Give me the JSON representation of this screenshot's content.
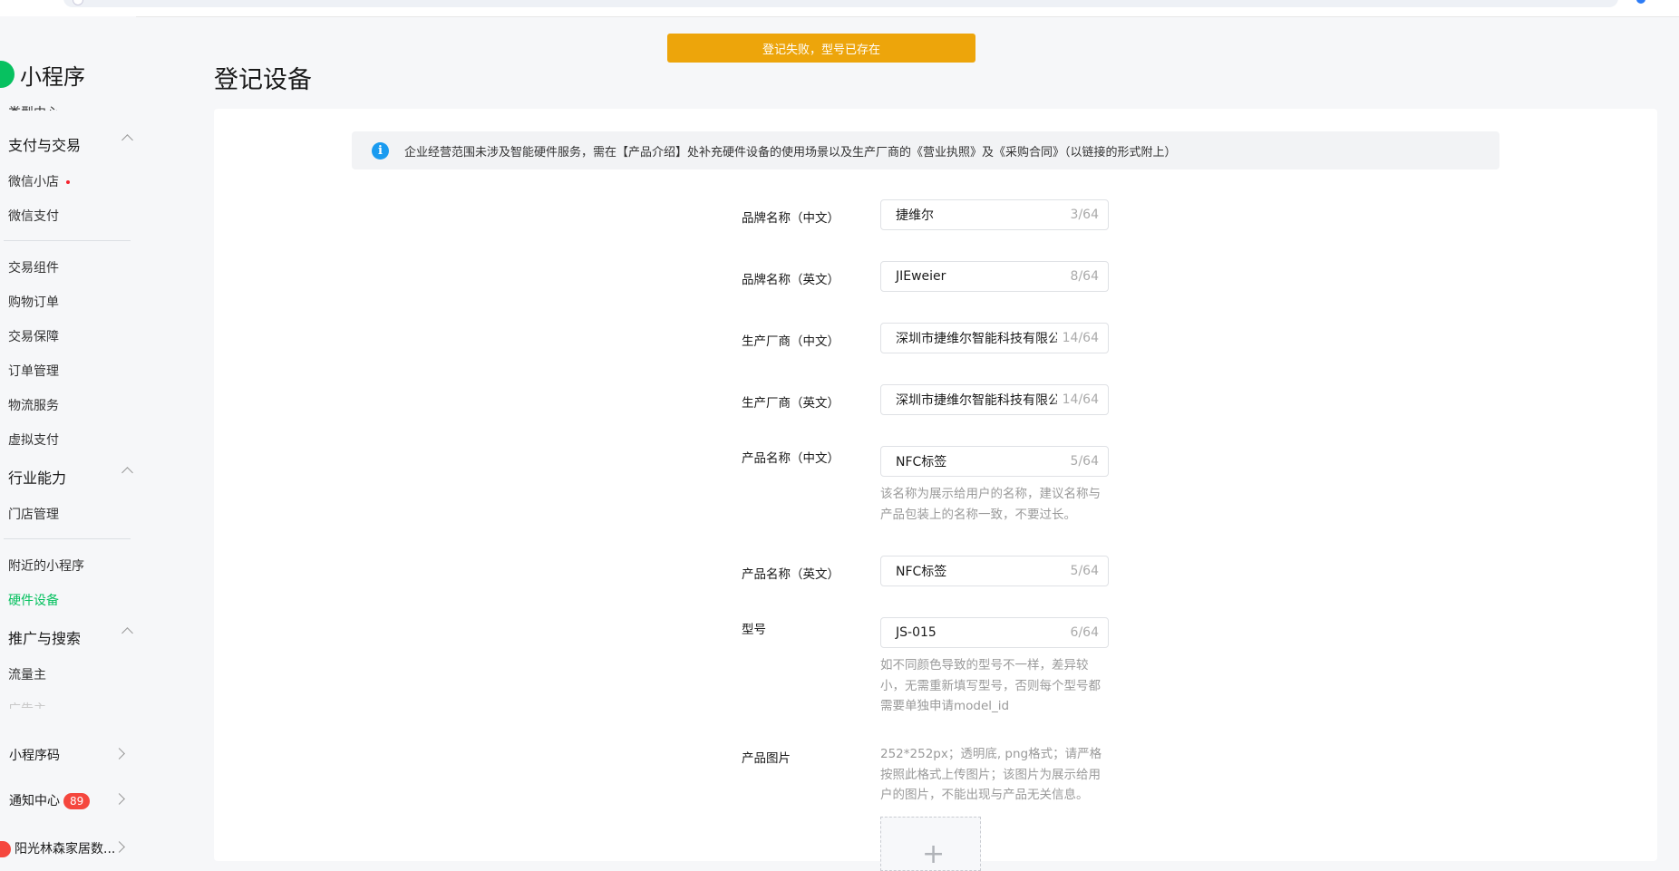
{
  "app": {
    "name": "小程序"
  },
  "toast": {
    "message": "登记失败，型号已存在"
  },
  "page": {
    "title": "登记设备"
  },
  "sidebar": {
    "cut_item": "类型中心",
    "pay_section": {
      "label": "支付与交易",
      "items": [
        "微信小店",
        "微信支付"
      ]
    },
    "trade_items": [
      "交易组件",
      "购物订单",
      "交易保障",
      "订单管理",
      "物流服务",
      "虚拟支付"
    ],
    "industry_section": {
      "label": "行业能力",
      "items": [
        "门店管理"
      ]
    },
    "industry_items2": [
      "附近的小程序",
      "硬件设备"
    ],
    "promo_section": {
      "label": "推广与搜索",
      "items": [
        "流量主",
        "广告主"
      ]
    },
    "bottom": {
      "qrcode": "小程序码",
      "notice": "通知中心",
      "notice_count": "89",
      "account": "阳光林森家居数..."
    }
  },
  "notice": {
    "text": "企业经营范围未涉及智能硬件服务，需在【产品介绍】处补充硬件设备的使用场景以及生产厂商的《营业执照》及《采购合同》（以链接的形式附上）"
  },
  "form": {
    "brand_cn": {
      "label": "品牌名称（中文）",
      "value": "捷维尔",
      "count": "3/64"
    },
    "brand_en": {
      "label": "品牌名称（英文）",
      "value": "JIEweier",
      "count": "8/64"
    },
    "maker_cn": {
      "label": "生产厂商（中文）",
      "value": "深圳市捷维尔智能科技有限公司",
      "count": "14/64"
    },
    "maker_en": {
      "label": "生产厂商（英文）",
      "value": "深圳市捷维尔智能科技有限公司",
      "count": "14/64"
    },
    "product_cn": {
      "label": "产品名称（中文）",
      "value": "NFC标签",
      "count": "5/64",
      "hint": "该名称为展示给用户的名称，建议名称与产品包装上的名称一致，不要过长。"
    },
    "product_en": {
      "label": "产品名称（英文）",
      "value": "NFC标签",
      "count": "5/64"
    },
    "model": {
      "label": "型号",
      "value": "JS-015",
      "count": "6/64",
      "hint": "如不同颜色导致的型号不一样，差异较小，无需重新填写型号，否则每个型号都需要单独申请model_id"
    },
    "image": {
      "label": "产品图片",
      "hint": "252*252px；透明底, png格式；请严格按照此格式上传图片；该图片为展示给用户的图片，不能出现与产品无关信息。",
      "plus": "+"
    }
  }
}
